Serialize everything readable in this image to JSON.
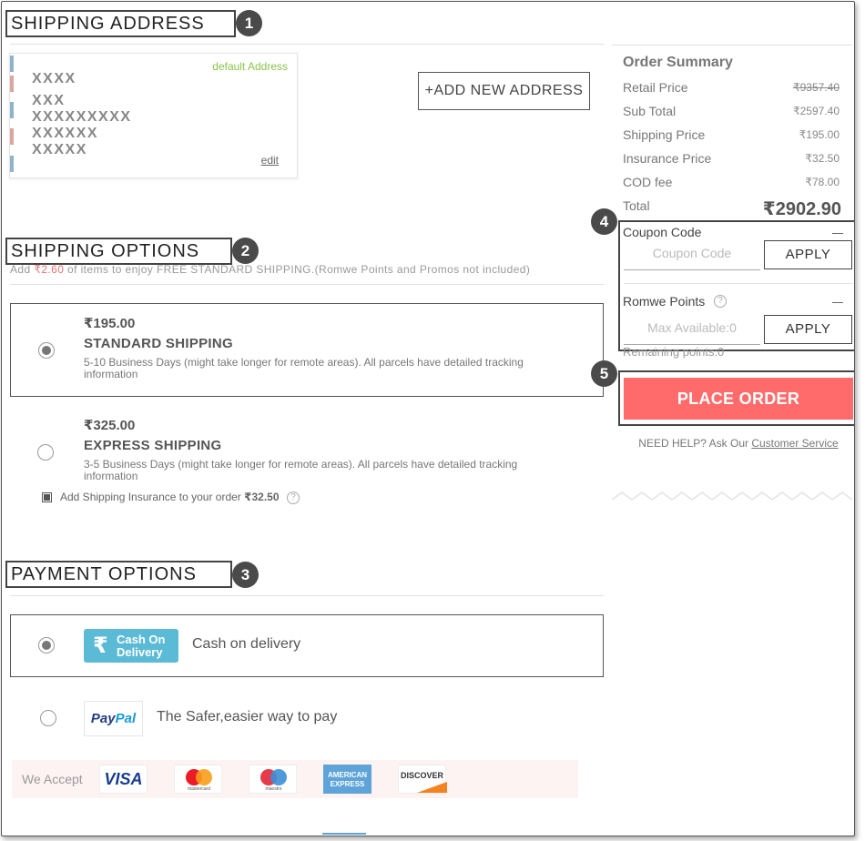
{
  "sections": {
    "shipping_address": {
      "title": "SHIPPING ADDRESS",
      "step": "1"
    },
    "shipping_options": {
      "title": "SHIPPING OPTIONS",
      "step": "2"
    },
    "payment_options": {
      "title": "PAYMENT OPTIONS",
      "step": "3"
    }
  },
  "address": {
    "default_label": "default Address",
    "lines": [
      "XXXX",
      "XXX",
      "XXXXXXXXX",
      "XXXXXX",
      "XXXXX"
    ],
    "edit_label": "edit"
  },
  "add_address_label": "+ADD NEW ADDRESS",
  "shipping": {
    "note_pre": "Add ",
    "note_amount": "₹2.60",
    "note_post": " of items to enjoy FREE STANDARD SHIPPING.(Romwe Points and Promos not included)",
    "options": [
      {
        "price": "₹195.00",
        "name": "STANDARD SHIPPING",
        "desc": "5-10 Business Days (might take longer for remote areas). All parcels have detailed tracking information",
        "selected": true
      },
      {
        "price": "₹325.00",
        "name": "EXPRESS SHIPPING",
        "desc": "3-5 Business Days (might take longer for remote areas). All parcels have detailed tracking information",
        "selected": false
      }
    ],
    "insurance_pre": "Add Shipping Insurance to your order ",
    "insurance_amount": "₹32.50",
    "help_glyph": "?"
  },
  "payment": {
    "cod_badge_line1": "Cash On",
    "cod_badge_line2": "Delivery",
    "cod_label": "Cash on delivery",
    "paypal_logo_pay": "Pay",
    "paypal_logo_pal": "Pal",
    "paypal_label": "The Safer,easier way to pay",
    "we_accept": "We Accept",
    "cards": {
      "visa": "VISA",
      "mastercard": "mastercard",
      "maestro": "maestro",
      "amex_line1": "AMERICAN",
      "amex_line2": "EXPRESS",
      "discover": "DISCOVER"
    }
  },
  "summary": {
    "title": "Order Summary",
    "rows": [
      {
        "label": "Retail Price",
        "value": "₹9357.40",
        "strike": true
      },
      {
        "label": "Sub Total",
        "value": "₹2597.40",
        "strike": false
      },
      {
        "label": "Shipping Price",
        "value": "₹195.00",
        "strike": false
      },
      {
        "label": "Insurance Price",
        "value": "₹32.50",
        "strike": false
      },
      {
        "label": "COD fee",
        "value": "₹78.00",
        "strike": false
      }
    ],
    "total_label": "Total",
    "total_value": "₹2902.90"
  },
  "promo": {
    "step": "4",
    "coupon_title": "Coupon Code",
    "coupon_placeholder": "Coupon Code",
    "apply_label": "APPLY",
    "points_title": "Romwe Points",
    "points_placeholder": "Max Available:0",
    "remaining": "Remaining points:0"
  },
  "order": {
    "step": "5",
    "place_label": "PLACE ORDER",
    "help_pre": "NEED HELP? Ask Our ",
    "help_link": "Customer Service"
  },
  "colors": {
    "accent_red": "#ff6b6b",
    "cod_blue": "#5bbad5",
    "default_green": "#8bc34a"
  }
}
